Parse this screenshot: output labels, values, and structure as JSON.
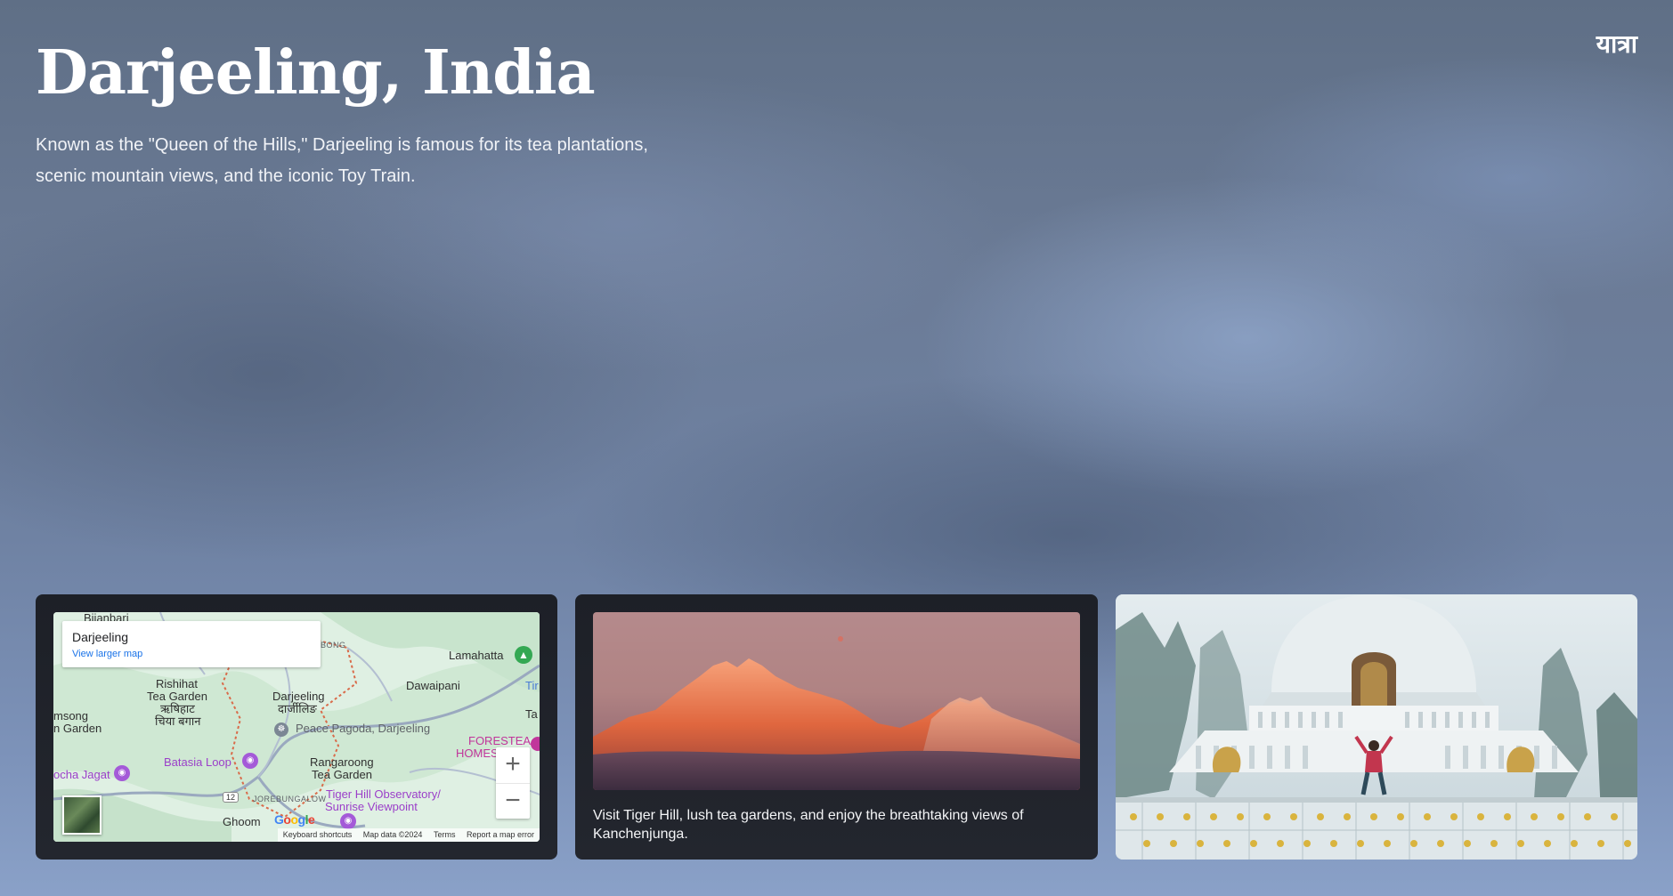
{
  "header": {
    "title": "Darjeeling, India",
    "description": "Known as the \"Queen of the Hills,\" Darjeeling is famous for its tea plantations, scenic mountain views, and the iconic Toy Train.",
    "brand": "यात्रा"
  },
  "map": {
    "place_name": "Darjeeling",
    "view_larger_map": "View larger map",
    "zoom_in": "+",
    "zoom_out": "−",
    "google": "Google",
    "labels": {
      "bijanbari": "Bijanbari",
      "lamahatta": "Lamahatta",
      "rishihat": "Rishihat",
      "tea_garden": "Tea Garden",
      "rishihat_hindi": "ऋषिहाट",
      "rishihat_bengali": "चिया बगान",
      "darjeeling": "Darjeeling",
      "darjeeling_hindi": "दार्जीलिङ",
      "dawaipani": "Dawaipani",
      "msong": "msong",
      "msong_garden": "n Garden",
      "peace_pagoda": "Peace Pagoda, Darjeeling",
      "batasia_loop": "Batasia Loop",
      "rangaroong": "Rangaroong",
      "rangaroong_garden": "Tea Garden",
      "cha_jagat": "ocha Jagat",
      "forestea": "FORESTEA",
      "homes": "HOMES",
      "jorebungalow": "JOREBUNGALOW",
      "tiger_hill": "Tiger Hill Observatory/",
      "sunrise": "Sunrise Viewpoint",
      "ghoom": "Ghoom",
      "tin": "Tir",
      "ta": "Ta",
      "bong": "BONG",
      "road_12": "12"
    },
    "attribution": {
      "keyboard": "Keyboard shortcuts",
      "mapdata": "Map data ©2024",
      "terms": "Terms",
      "report": "Report a map error"
    }
  },
  "mountain_card": {
    "caption": "Visit Tiger Hill, lush tea gardens, and enjoy the breathtaking views of Kanchenjunga."
  },
  "colors": {
    "card_dark": "#1d2027",
    "map_land": "#dceee0",
    "map_link": "#1a73e8",
    "poi_purple": "#9b3fc9",
    "poi_magenta": "#c1359b",
    "park_green": "#34a853"
  },
  "icons": [
    "park-pin-icon",
    "peace-pagoda-icon",
    "camera-pin-icon",
    "zoom-in-icon",
    "zoom-out-icon",
    "satellite-thumbnail"
  ]
}
